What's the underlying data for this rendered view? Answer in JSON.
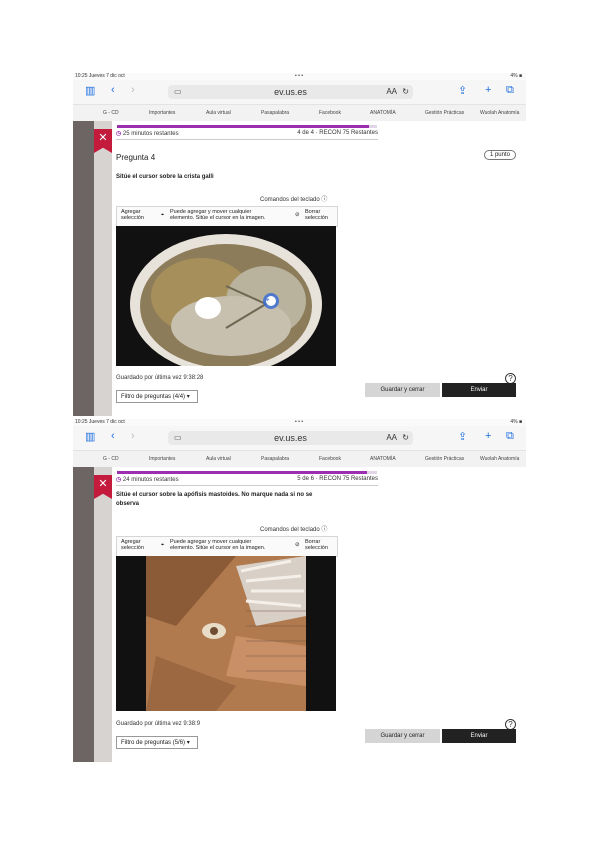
{
  "shots": [
    {
      "status": {
        "left": "10:25  Jueves 7 dic oct",
        "center": "• • •",
        "right": "4% ■"
      },
      "url": "ev.us.es",
      "aa": "AA",
      "bookmarks": [
        "G - CD",
        "Importantes",
        "Aula virtual",
        "Pasapalabra",
        "Facebook",
        "ANATOMÍA",
        "Gestión Prácticas",
        "Wuolah Anatomía"
      ],
      "progress_fraction": 0.97,
      "time_remaining": "25 minutos restantes",
      "status_line": "4 de 4 · RECON 75 Restantes",
      "question_title": "Pregunta 4",
      "points": "1 punto",
      "instruction": "Sitúe el cursor sobre la crista galli",
      "keyboard_link": "Comandos del teclado",
      "toolbar": {
        "add": "Agregar selección",
        "hint": "Puede agregar y mover cualquier elemento. Sitúe el cursor en la imagen.",
        "clear": "Borrar selección"
      },
      "saved": "Guardado por última vez 9:38:28",
      "filter": "Filtro de preguntas (4/4)",
      "prev_label": "Guardar y cerrar",
      "next_label": "Enviar"
    },
    {
      "status": {
        "left": "10:25  Jueves 7 dic oct",
        "center": "• • •",
        "right": "4% ■"
      },
      "url": "ev.us.es",
      "aa": "AA",
      "bookmarks": [
        "G - CD",
        "Importantes",
        "Aula virtual",
        "Pasapalabra",
        "Facebook",
        "ANATOMÍA",
        "Gestión Prácticas",
        "Wuolah Anatomía"
      ],
      "progress_fraction": 0.96,
      "time_remaining": "24 minutos restantes",
      "status_line": "5 de 6 · RECON 75 Restantes",
      "instruction": "Sitúe el cursor sobre la apófisis mastoides. No marque nada si no se observa",
      "keyboard_link": "Comandos del teclado",
      "toolbar": {
        "add": "Agregar selección",
        "hint": "Puede agregar y mover cualquier elemento. Sitúe el cursor en la imagen.",
        "clear": "Borrar selección"
      },
      "saved": "Guardado por última vez 9:38:9",
      "filter": "Filtro de preguntas (5/6)",
      "prev_label": "Guardar y cerrar",
      "next_label": "Enviar"
    }
  ]
}
